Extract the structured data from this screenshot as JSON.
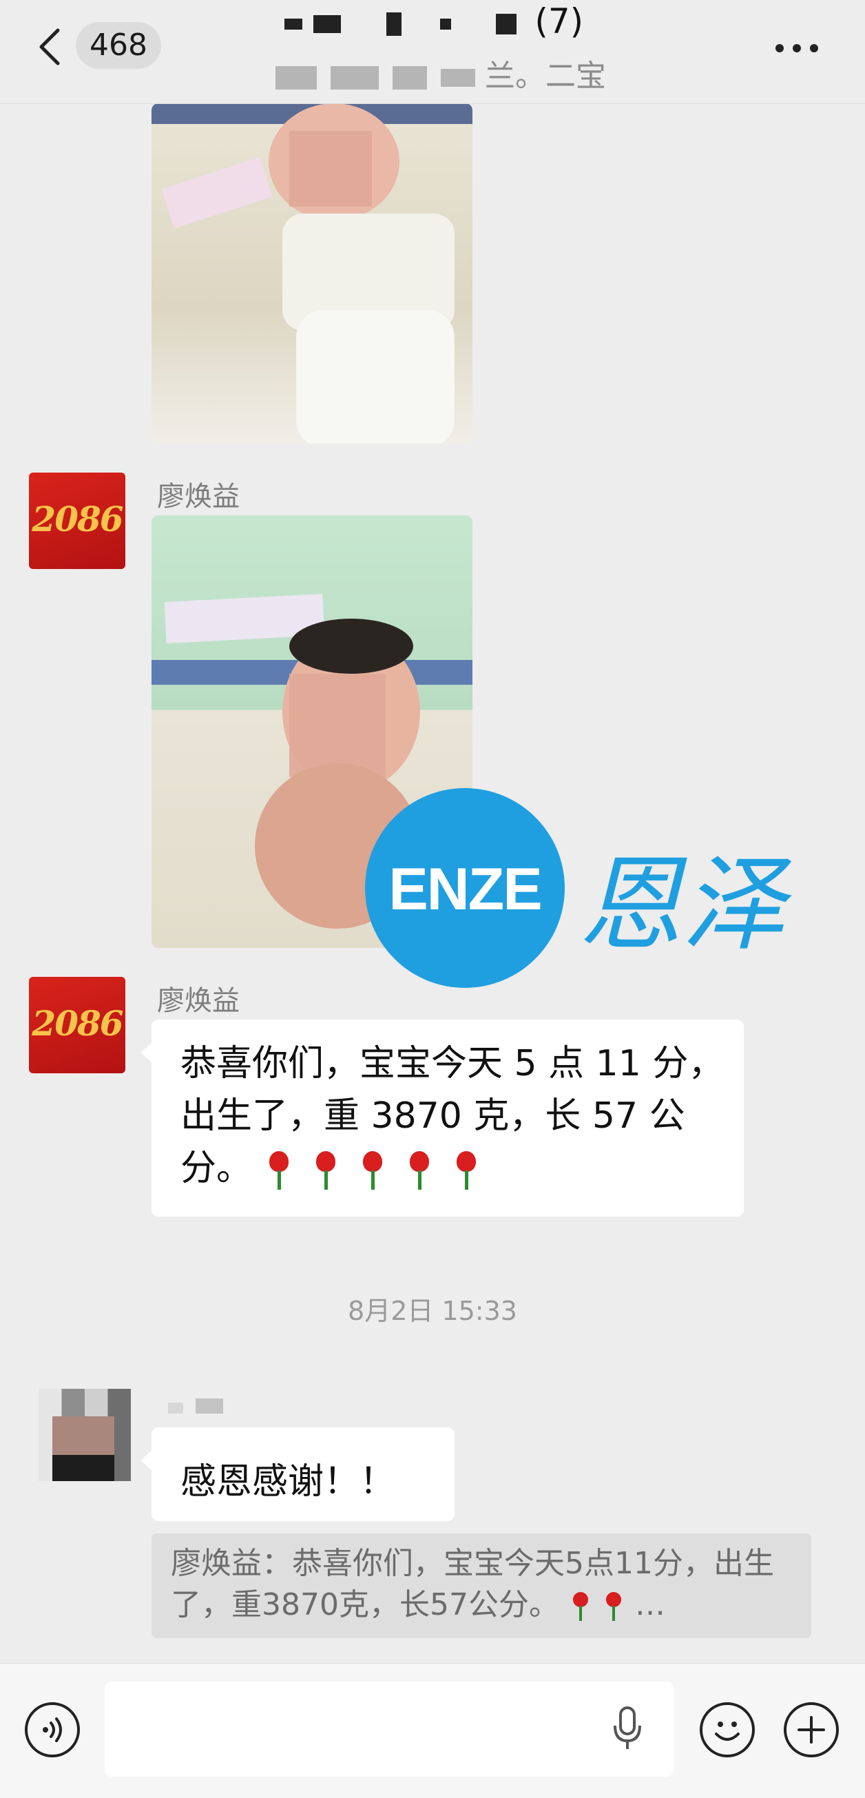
{
  "header": {
    "unread_count": "468",
    "title_visible": "(7)",
    "subtitle_visible": "兰。二宝"
  },
  "messages": [
    {
      "sender": "廖焕益",
      "type": "image"
    },
    {
      "sender": "廖焕益",
      "type": "text",
      "text": "恭喜你们，宝宝今天 5 点 11 分，出生了，重 3870 克，长 57 公分。"
    }
  ],
  "timestamp": "8月2日 15:33",
  "reply": {
    "text": "感恩感谢！！",
    "quote": "廖焕益：恭喜你们，宝宝今天5点11分，出生了，重3870克，长57公分。",
    "quote_ellipsis": "…"
  },
  "avatar_label": "2086",
  "watermark": {
    "latin": "ENZE",
    "chinese": "恩泽"
  },
  "emoji": {
    "flower_count": 5,
    "quote_flower_count": 2
  },
  "colors": {
    "accent_blue": "#1f9fe0",
    "avatar_red": "#d9241b",
    "bubble": "#ffffff",
    "background": "#ededed"
  },
  "icons": [
    "back-arrow-icon",
    "more-icon",
    "voice-mode-icon",
    "microphone-icon",
    "emoji-icon",
    "plus-icon"
  ]
}
